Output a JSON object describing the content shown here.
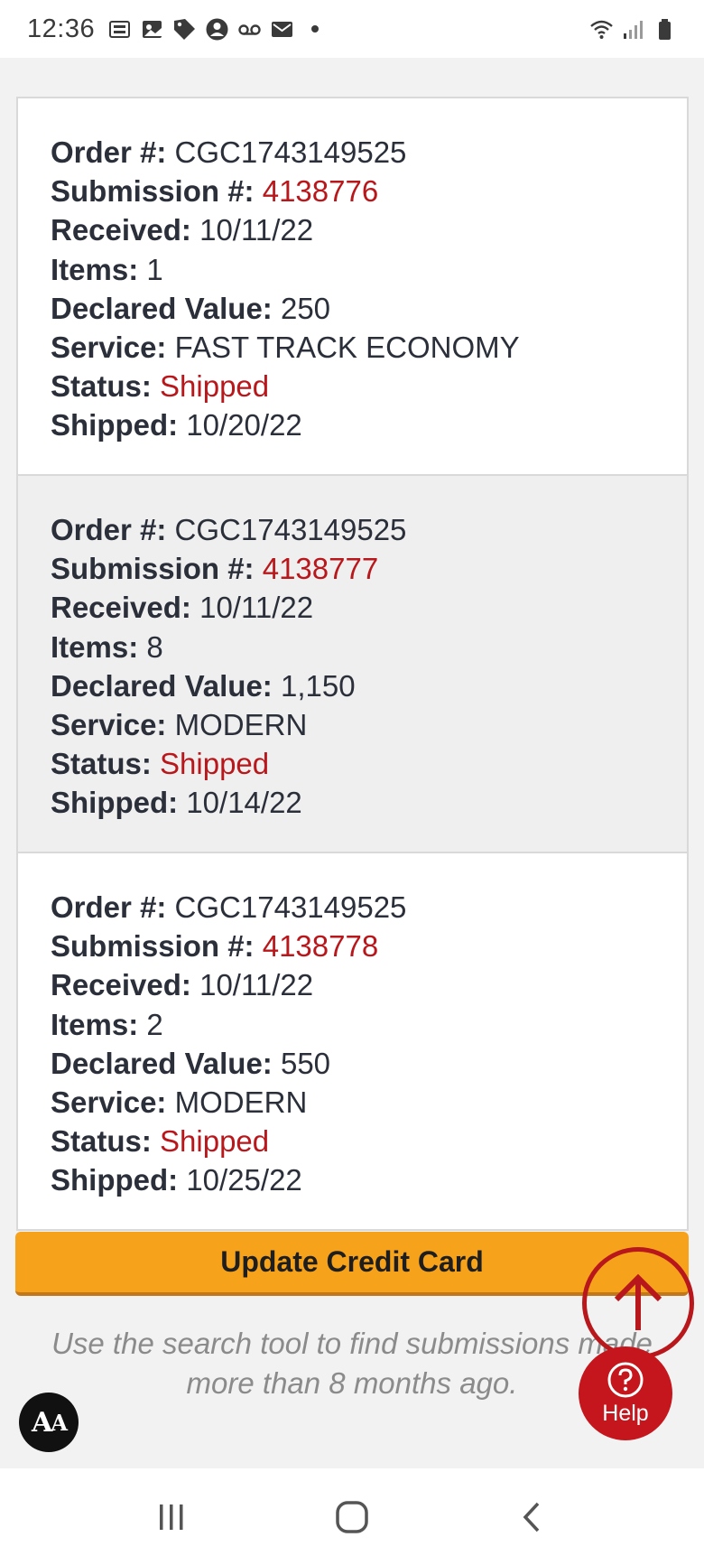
{
  "status_bar": {
    "time": "12:36",
    "left_icons": [
      "temu-notification-icon",
      "photo-notification-icon",
      "tag-notification-icon",
      "account-notification-icon",
      "voicemail-icon",
      "mail-icon"
    ],
    "right_icons": [
      "wifi-icon",
      "signal-icon",
      "battery-icon"
    ]
  },
  "orders": [
    {
      "order_label": "Order #:",
      "order_value": "CGC1743149525",
      "submission_label": "Submission #:",
      "submission_value": "4138776",
      "received_label": "Received:",
      "received_value": "10/11/22",
      "items_label": "Items:",
      "items_value": "1",
      "declared_label": "Declared Value:",
      "declared_value": "250",
      "service_label": "Service:",
      "service_value": "FAST TRACK ECONOMY",
      "status_label": "Status:",
      "status_value": "Shipped",
      "shipped_label": "Shipped:",
      "shipped_value": "10/20/22"
    },
    {
      "order_label": "Order #:",
      "order_value": "CGC1743149525",
      "submission_label": "Submission #:",
      "submission_value": "4138777",
      "received_label": "Received:",
      "received_value": "10/11/22",
      "items_label": "Items:",
      "items_value": "8",
      "declared_label": "Declared Value:",
      "declared_value": "1,150",
      "service_label": "Service:",
      "service_value": "MODERN",
      "status_label": "Status:",
      "status_value": "Shipped",
      "shipped_label": "Shipped:",
      "shipped_value": "10/14/22"
    },
    {
      "order_label": "Order #:",
      "order_value": "CGC1743149525",
      "submission_label": "Submission #:",
      "submission_value": "4138778",
      "received_label": "Received:",
      "received_value": "10/11/22",
      "items_label": "Items:",
      "items_value": "2",
      "declared_label": "Declared Value:",
      "declared_value": "550",
      "service_label": "Service:",
      "service_value": "MODERN",
      "status_label": "Status:",
      "status_value": "Shipped",
      "shipped_label": "Shipped:",
      "shipped_value": "10/25/22"
    }
  ],
  "update_button": {
    "label": "Update Credit Card"
  },
  "hint": {
    "line1": "Use the search tool to find submissions made",
    "line2": "more than 8 months ago."
  },
  "help": {
    "label": "Help",
    "icon": "question-circle-icon"
  },
  "scroll_top": {
    "icon": "arrow-up-icon"
  },
  "accessibility": {
    "big": "A",
    "small": "A"
  },
  "nav": {
    "icons": [
      "recent-apps-icon",
      "home-icon",
      "back-icon"
    ]
  },
  "colors": {
    "accent_red": "#b8171b",
    "button_orange": "#f7a21b",
    "help_red": "#c4161c",
    "hint_gray": "#8b8b8b"
  }
}
